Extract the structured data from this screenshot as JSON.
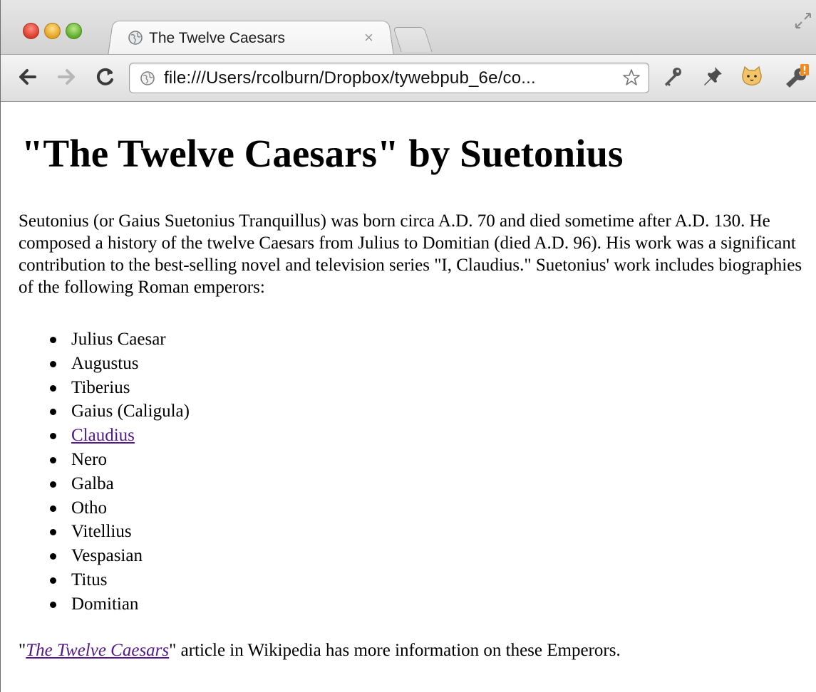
{
  "browser": {
    "tab": {
      "title": "The Twelve Caesars",
      "close_glyph": "×"
    },
    "address_bar": {
      "url": "file:///Users/rcolburn/Dropbox/tywebpub_6e/co..."
    },
    "icons": [
      "back-icon",
      "forward-icon",
      "reload-icon",
      "globe-icon",
      "bookmark-star-icon",
      "key-icon",
      "pin-icon",
      "cat-icon",
      "wrench-icon",
      "fullscreen-icon"
    ]
  },
  "page": {
    "heading": "\"The Twelve Caesars\" by Suetonius",
    "intro": "Seutonius (or Gaius Suetonius Tranquillus) was born circa A.D. 70 and died sometime after A.D. 130. He composed a history of the twelve Caesars from Julius to Domitian (died A.D. 96). His work was a significant contribution to the best-selling novel and television series \"I, Claudius.\" Suetonius' work includes biographies of the following Roman emperors:",
    "emperors": [
      {
        "name": "Julius Caesar",
        "link": false
      },
      {
        "name": "Augustus",
        "link": false
      },
      {
        "name": "Tiberius",
        "link": false
      },
      {
        "name": "Gaius (Caligula)",
        "link": false
      },
      {
        "name": "Claudius",
        "link": true
      },
      {
        "name": "Nero",
        "link": false
      },
      {
        "name": "Galba",
        "link": false
      },
      {
        "name": "Otho",
        "link": false
      },
      {
        "name": "Vitellius",
        "link": false
      },
      {
        "name": "Vespasian",
        "link": false
      },
      {
        "name": "Titus",
        "link": false
      },
      {
        "name": "Domitian",
        "link": false
      }
    ],
    "footer": {
      "open_quote": "\"",
      "link_text": "The Twelve Caesars",
      "rest": "\" article in Wikipedia has more information on these Emperors."
    }
  },
  "colors": {
    "visited_link": "#52188c",
    "text": "#000000"
  }
}
